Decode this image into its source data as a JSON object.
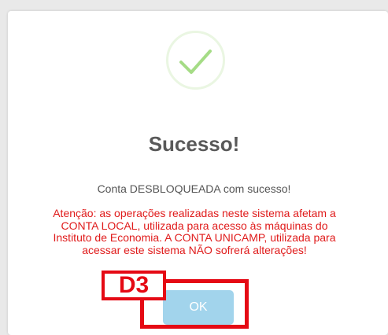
{
  "dialog": {
    "icon": "checkmark-circle-icon",
    "title": "Sucesso!",
    "message": "Conta DESBLOQUEADA com sucesso!",
    "warning_lines": [
      "Atenção: as operações realizadas neste sistema afetam a",
      "CONTA LOCAL, utilizada para acesso às máquinas do",
      "Instituto de Economia. A CONTA UNICAMP, utilizada para",
      "acessar este sistema NÃO sofrerá alterações!"
    ],
    "ok_label": "OK"
  },
  "annotation": {
    "step_label": "D3"
  },
  "colors": {
    "success_green": "#a5dc86",
    "success_ring": "#eaf6e2",
    "warning_red": "#e01b1b",
    "button_blue": "#a2d4ec",
    "annotation_red": "#e50914"
  }
}
